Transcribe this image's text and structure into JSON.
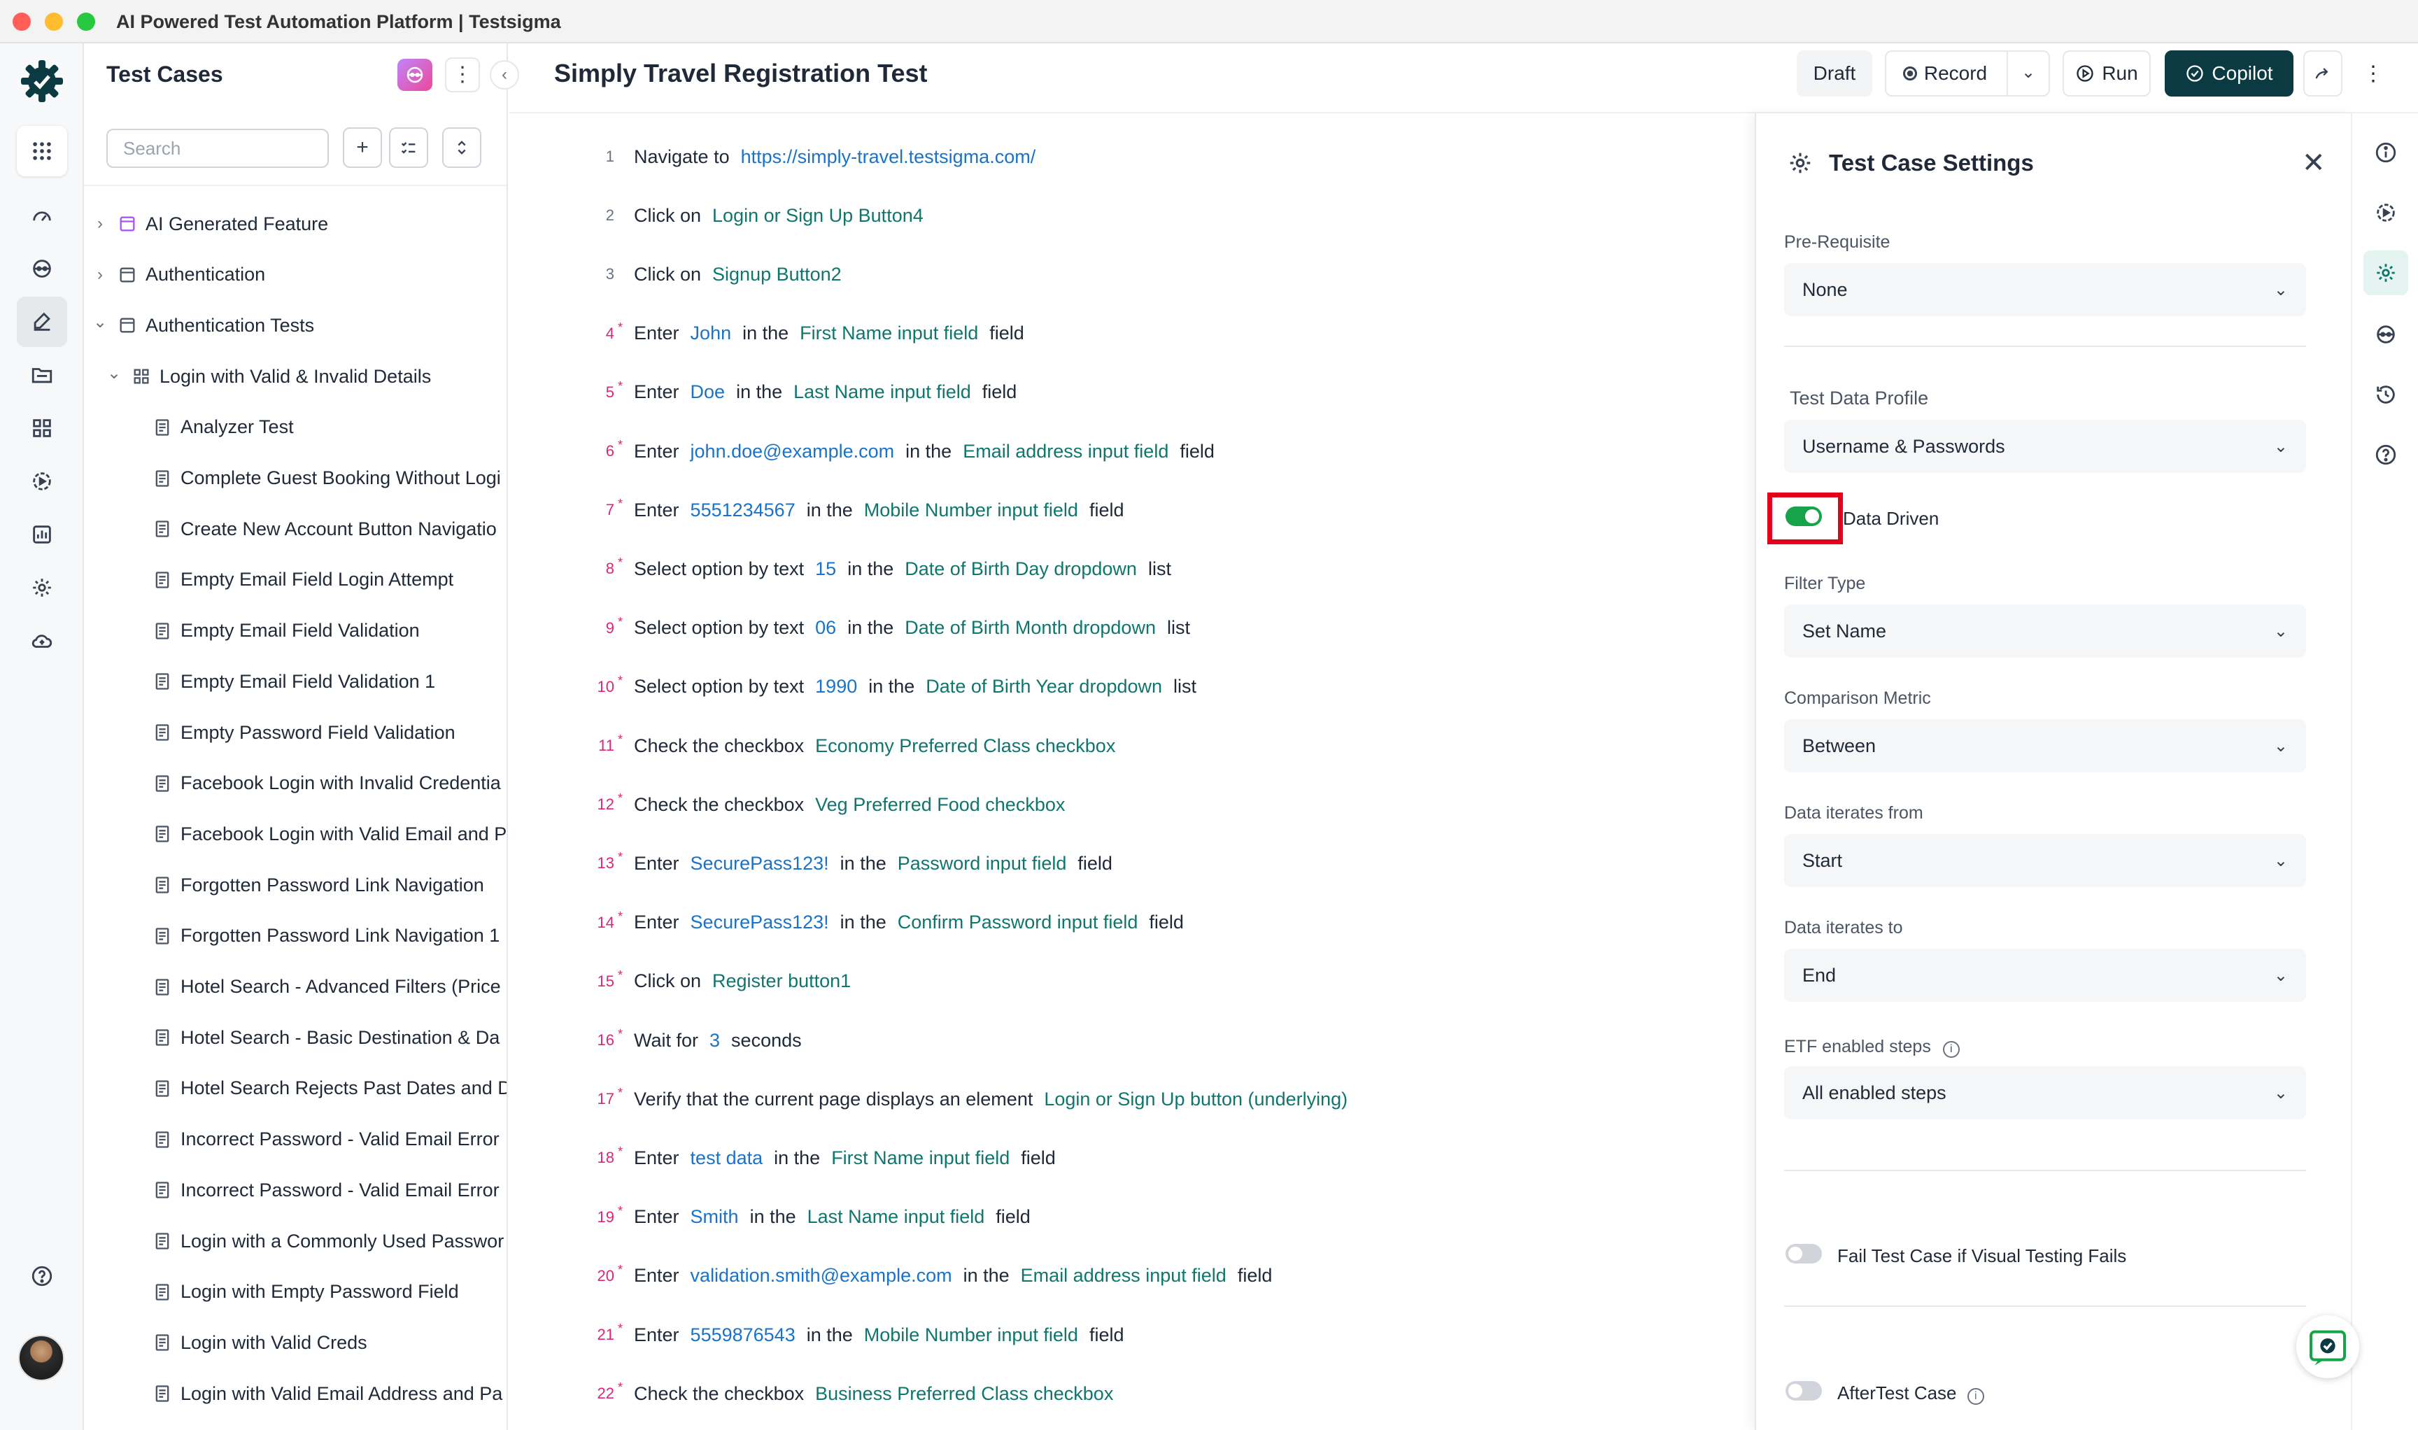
{
  "window": {
    "title": "AI Powered Test Automation Platform | Testsigma"
  },
  "sidebar": {
    "title": "Test Cases",
    "search_placeholder": "Search",
    "tree": [
      {
        "label": "AI Generated Feature",
        "level": 0,
        "type": "feature-ai",
        "expanded": false
      },
      {
        "label": "Authentication",
        "level": 0,
        "type": "feature",
        "expanded": false
      },
      {
        "label": "Authentication Tests",
        "level": 0,
        "type": "feature",
        "expanded": true
      },
      {
        "label": "Login with Valid & Invalid Details",
        "level": 1,
        "type": "scenario",
        "expanded": true
      },
      {
        "label": "Analyzer Test",
        "level": 2,
        "type": "case"
      },
      {
        "label": "Complete Guest Booking Without Logi",
        "level": 2,
        "type": "case"
      },
      {
        "label": "Create New Account Button Navigatio",
        "level": 2,
        "type": "case"
      },
      {
        "label": "Empty Email Field Login Attempt",
        "level": 2,
        "type": "case"
      },
      {
        "label": "Empty Email Field Validation",
        "level": 2,
        "type": "case"
      },
      {
        "label": "Empty Email Field Validation 1",
        "level": 2,
        "type": "case"
      },
      {
        "label": "Empty Password Field Validation",
        "level": 2,
        "type": "case"
      },
      {
        "label": "Facebook Login with Invalid Credentia",
        "level": 2,
        "type": "case"
      },
      {
        "label": "Facebook Login with Valid Email and P",
        "level": 2,
        "type": "case"
      },
      {
        "label": "Forgotten Password Link Navigation",
        "level": 2,
        "type": "case"
      },
      {
        "label": "Forgotten Password Link Navigation 1",
        "level": 2,
        "type": "case"
      },
      {
        "label": "Hotel Search - Advanced Filters (Price",
        "level": 2,
        "type": "case"
      },
      {
        "label": "Hotel Search - Basic Destination & Da",
        "level": 2,
        "type": "case"
      },
      {
        "label": "Hotel Search Rejects Past Dates and D",
        "level": 2,
        "type": "case"
      },
      {
        "label": "Incorrect Password - Valid Email Error",
        "level": 2,
        "type": "case"
      },
      {
        "label": "Incorrect Password - Valid Email Error",
        "level": 2,
        "type": "case"
      },
      {
        "label": "Login with a Commonly Used Passwor",
        "level": 2,
        "type": "case"
      },
      {
        "label": "Login with Empty Password Field",
        "level": 2,
        "type": "case"
      },
      {
        "label": "Login with Valid Creds",
        "level": 2,
        "type": "case"
      },
      {
        "label": "Login with Valid Email Address and Pa",
        "level": 2,
        "type": "case"
      }
    ]
  },
  "header": {
    "test_case_title": "Simply Travel Registration Test",
    "draft_label": "Draft",
    "record_label": "Record",
    "run_label": "Run",
    "copilot_label": "Copilot"
  },
  "steps": [
    {
      "n": "1",
      "star": false,
      "parts": [
        [
          "t",
          "Navigate to"
        ],
        [
          "v",
          "https://simply-travel.testsigma.com/"
        ]
      ]
    },
    {
      "n": "2",
      "star": false,
      "parts": [
        [
          "t",
          "Click on"
        ],
        [
          "e",
          "Login or Sign Up Button4"
        ]
      ]
    },
    {
      "n": "3",
      "star": false,
      "parts": [
        [
          "t",
          "Click on"
        ],
        [
          "e",
          "Signup Button2"
        ]
      ]
    },
    {
      "n": "4",
      "star": true,
      "parts": [
        [
          "t",
          "Enter"
        ],
        [
          "v",
          "John"
        ],
        [
          "t",
          "in the"
        ],
        [
          "e",
          "First Name input field"
        ],
        [
          "t",
          "field"
        ]
      ]
    },
    {
      "n": "5",
      "star": true,
      "parts": [
        [
          "t",
          "Enter"
        ],
        [
          "v",
          "Doe"
        ],
        [
          "t",
          "in the"
        ],
        [
          "e",
          "Last Name input field"
        ],
        [
          "t",
          "field"
        ]
      ]
    },
    {
      "n": "6",
      "star": true,
      "parts": [
        [
          "t",
          "Enter"
        ],
        [
          "v",
          "john.doe@example.com"
        ],
        [
          "t",
          "in the"
        ],
        [
          "e",
          "Email address input field"
        ],
        [
          "t",
          "field"
        ]
      ]
    },
    {
      "n": "7",
      "star": true,
      "parts": [
        [
          "t",
          "Enter"
        ],
        [
          "v",
          "5551234567"
        ],
        [
          "t",
          "in the"
        ],
        [
          "e",
          "Mobile Number input field"
        ],
        [
          "t",
          "field"
        ]
      ]
    },
    {
      "n": "8",
      "star": true,
      "parts": [
        [
          "t",
          "Select option by text"
        ],
        [
          "v",
          "15"
        ],
        [
          "t",
          "in the"
        ],
        [
          "e",
          "Date of Birth Day dropdown"
        ],
        [
          "t",
          "list"
        ]
      ]
    },
    {
      "n": "9",
      "star": true,
      "parts": [
        [
          "t",
          "Select option by text"
        ],
        [
          "v",
          "06"
        ],
        [
          "t",
          "in the"
        ],
        [
          "e",
          "Date of Birth Month dropdown"
        ],
        [
          "t",
          "list"
        ]
      ]
    },
    {
      "n": "10",
      "star": true,
      "parts": [
        [
          "t",
          "Select option by text"
        ],
        [
          "v",
          "1990"
        ],
        [
          "t",
          "in the"
        ],
        [
          "e",
          "Date of Birth Year dropdown"
        ],
        [
          "t",
          "list"
        ]
      ]
    },
    {
      "n": "11",
      "star": true,
      "parts": [
        [
          "t",
          "Check the checkbox"
        ],
        [
          "e",
          "Economy Preferred Class checkbox"
        ]
      ]
    },
    {
      "n": "12",
      "star": true,
      "parts": [
        [
          "t",
          "Check the checkbox"
        ],
        [
          "e",
          "Veg Preferred Food checkbox"
        ]
      ]
    },
    {
      "n": "13",
      "star": true,
      "parts": [
        [
          "t",
          "Enter"
        ],
        [
          "v",
          "SecurePass123!"
        ],
        [
          "t",
          "in the"
        ],
        [
          "e",
          "Password input field"
        ],
        [
          "t",
          "field"
        ]
      ]
    },
    {
      "n": "14",
      "star": true,
      "parts": [
        [
          "t",
          "Enter"
        ],
        [
          "v",
          "SecurePass123!"
        ],
        [
          "t",
          "in the"
        ],
        [
          "e",
          "Confirm Password input field"
        ],
        [
          "t",
          "field"
        ]
      ]
    },
    {
      "n": "15",
      "star": true,
      "parts": [
        [
          "t",
          "Click on"
        ],
        [
          "e",
          "Register button1"
        ]
      ]
    },
    {
      "n": "16",
      "star": true,
      "parts": [
        [
          "t",
          "Wait for"
        ],
        [
          "v",
          "3"
        ],
        [
          "t",
          "seconds"
        ]
      ]
    },
    {
      "n": "17",
      "star": true,
      "parts": [
        [
          "t",
          "Verify that the current page displays an element"
        ],
        [
          "e",
          "Login or Sign Up button (underlying)"
        ]
      ]
    },
    {
      "n": "18",
      "star": true,
      "parts": [
        [
          "t",
          "Enter"
        ],
        [
          "v",
          "test data"
        ],
        [
          "t",
          "in the"
        ],
        [
          "e",
          "First Name input field"
        ],
        [
          "t",
          "field"
        ]
      ]
    },
    {
      "n": "19",
      "star": true,
      "parts": [
        [
          "t",
          "Enter"
        ],
        [
          "v",
          "Smith"
        ],
        [
          "t",
          "in the"
        ],
        [
          "e",
          "Last Name input field"
        ],
        [
          "t",
          "field"
        ]
      ]
    },
    {
      "n": "20",
      "star": true,
      "parts": [
        [
          "t",
          "Enter"
        ],
        [
          "v",
          "validation.smith@example.com"
        ],
        [
          "t",
          "in the"
        ],
        [
          "e",
          "Email address input field"
        ],
        [
          "t",
          "field"
        ]
      ]
    },
    {
      "n": "21",
      "star": true,
      "parts": [
        [
          "t",
          "Enter"
        ],
        [
          "v",
          "5559876543"
        ],
        [
          "t",
          "in the"
        ],
        [
          "e",
          "Mobile Number input field"
        ],
        [
          "t",
          "field"
        ]
      ]
    },
    {
      "n": "22",
      "star": true,
      "parts": [
        [
          "t",
          "Check the checkbox"
        ],
        [
          "e",
          "Business Preferred Class checkbox"
        ]
      ]
    }
  ],
  "settings": {
    "title": "Test Case Settings",
    "prerequisite": {
      "label": "Pre-Requisite",
      "value": "None"
    },
    "test_data_profile": {
      "label": "Test Data Profile",
      "value": "Username & Passwords"
    },
    "data_driven": {
      "label": "Data Driven",
      "enabled": true
    },
    "filter_type": {
      "label": "Filter Type",
      "value": "Set Name"
    },
    "comparison_metric": {
      "label": "Comparison Metric",
      "value": "Between"
    },
    "iterates_from": {
      "label": "Data iterates from",
      "value": "Start"
    },
    "iterates_to": {
      "label": "Data iterates to",
      "value": "End"
    },
    "etf_steps": {
      "label": "ETF enabled steps",
      "value": "All enabled steps"
    },
    "fail_visual": {
      "label": "Fail Test Case if Visual Testing Fails",
      "enabled": false
    },
    "after_test": {
      "label": "AfterTest Case",
      "enabled": false
    }
  },
  "colors": {
    "accent": "#0b3a42",
    "toggle_on": "#16a34a",
    "value_blue": "#1a73c8",
    "element_green": "#0f766e",
    "highlight": "#e4001b"
  }
}
